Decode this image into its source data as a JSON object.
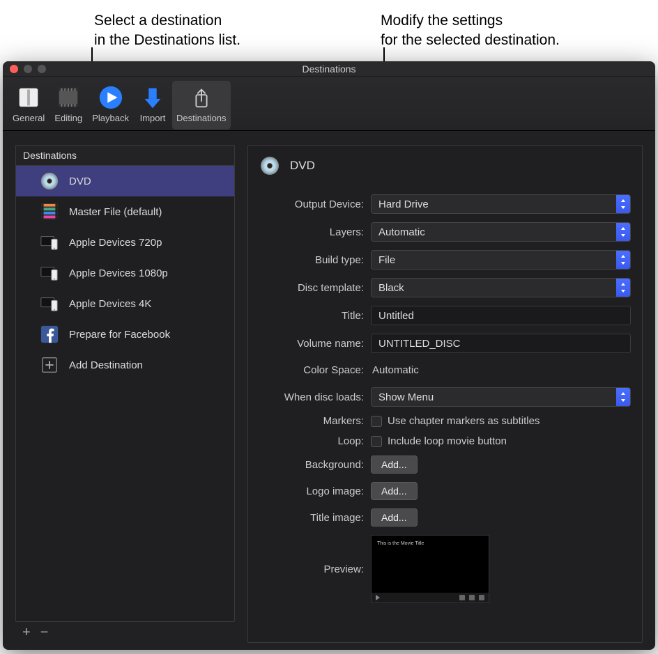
{
  "callouts": {
    "left": "Select a destination\nin the Destinations list.",
    "right": "Modify the settings\nfor the selected destination."
  },
  "window": {
    "title": "Destinations"
  },
  "toolbar": {
    "items": [
      {
        "id": "general",
        "label": "General",
        "selected": false
      },
      {
        "id": "editing",
        "label": "Editing",
        "selected": false
      },
      {
        "id": "playback",
        "label": "Playback",
        "selected": false
      },
      {
        "id": "import",
        "label": "Import",
        "selected": false
      },
      {
        "id": "destinations",
        "label": "Destinations",
        "selected": true
      }
    ]
  },
  "sidebar": {
    "header": "Destinations",
    "items": [
      {
        "id": "dvd",
        "label": "DVD",
        "icon": "disc-icon",
        "selected": true
      },
      {
        "id": "master",
        "label": "Master File (default)",
        "icon": "film-icon",
        "selected": false
      },
      {
        "id": "apple720",
        "label": "Apple Devices 720p",
        "icon": "devices-icon",
        "selected": false
      },
      {
        "id": "apple1080",
        "label": "Apple Devices 1080p",
        "icon": "devices-icon",
        "selected": false
      },
      {
        "id": "apple4k",
        "label": "Apple Devices 4K",
        "icon": "devices-icon",
        "selected": false
      },
      {
        "id": "facebook",
        "label": "Prepare for Facebook",
        "icon": "facebook-icon",
        "selected": false
      },
      {
        "id": "add",
        "label": "Add Destination",
        "icon": "add-icon",
        "selected": false
      }
    ],
    "footer": {
      "plus": "+",
      "minus": "−"
    }
  },
  "detail": {
    "title": "DVD",
    "fields": {
      "output_device": {
        "label": "Output Device:",
        "value": "Hard Drive"
      },
      "layers": {
        "label": "Layers:",
        "value": "Automatic"
      },
      "build_type": {
        "label": "Build type:",
        "value": "File"
      },
      "disc_template": {
        "label": "Disc template:",
        "value": "Black"
      },
      "title": {
        "label": "Title:",
        "value": "Untitled"
      },
      "volume_name": {
        "label": "Volume name:",
        "value": "UNTITLED_DISC"
      },
      "color_space": {
        "label": "Color Space:",
        "value": "Automatic"
      },
      "when_disc_loads": {
        "label": "When disc loads:",
        "value": "Show Menu"
      },
      "markers": {
        "label": "Markers:",
        "checkbox_label": "Use chapter markers as subtitles",
        "checked": false
      },
      "loop": {
        "label": "Loop:",
        "checkbox_label": "Include loop movie button",
        "checked": false
      },
      "background": {
        "label": "Background:",
        "button": "Add..."
      },
      "logo_image": {
        "label": "Logo image:",
        "button": "Add..."
      },
      "title_image": {
        "label": "Title image:",
        "button": "Add..."
      },
      "preview": {
        "label": "Preview:",
        "preview_title": "This is the Movie Title"
      }
    }
  }
}
